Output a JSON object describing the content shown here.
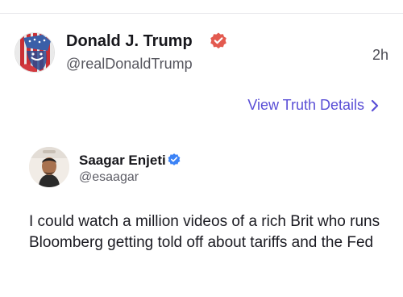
{
  "post": {
    "author_name": "Donald J. Trump",
    "author_handle": "@realDonaldTrump",
    "time": "2h",
    "view_details_label": "View Truth Details"
  },
  "quoted": {
    "author_name": "Saagar Enjeti",
    "author_handle": "@esaagar",
    "text": "I could watch a million videos of a rich Brit who runs Bloomberg getting told off about tariffs and the Fed"
  },
  "colors": {
    "accent": "#5a4fd6",
    "verified_main": "#e35a4f",
    "verified_quote": "#3b82f6"
  },
  "icons": {
    "verified_main": "verified-badge-icon",
    "chevron": "chevron-right-icon",
    "verified_quote": "verified-badge-icon"
  }
}
